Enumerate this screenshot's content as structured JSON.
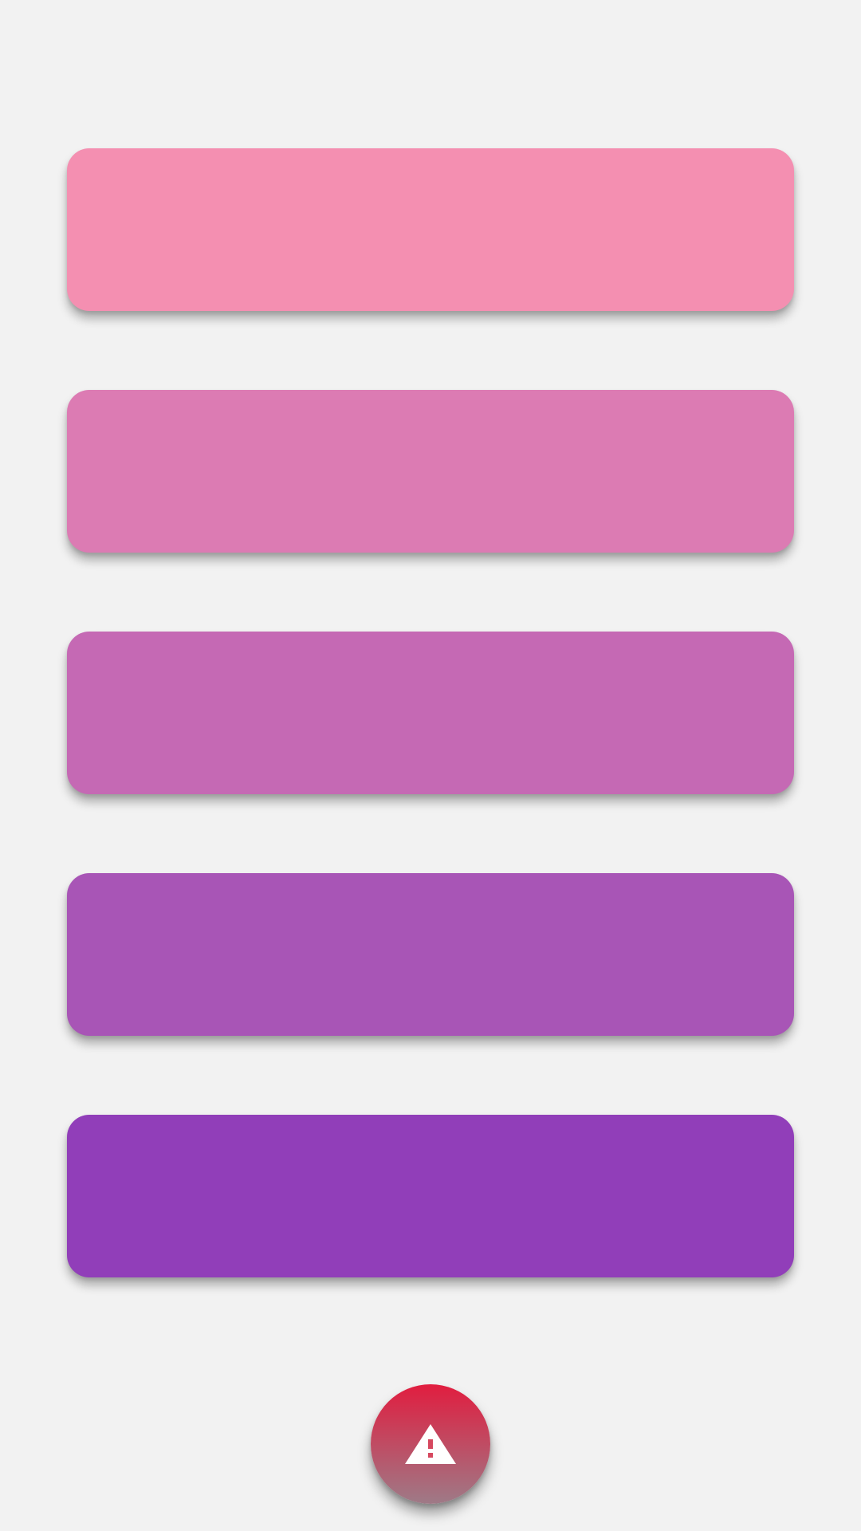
{
  "cards": [
    {
      "color": "#f48fb1"
    },
    {
      "color": "#dc7bb3"
    },
    {
      "color": "#c569b4"
    },
    {
      "color": "#a855b6"
    },
    {
      "color": "#913eb9"
    }
  ],
  "fab": {
    "icon": "warning-icon",
    "gradient_top": "#e11d3f",
    "gradient_bottom": "#9e7a87",
    "icon_color": "#ffffff"
  }
}
